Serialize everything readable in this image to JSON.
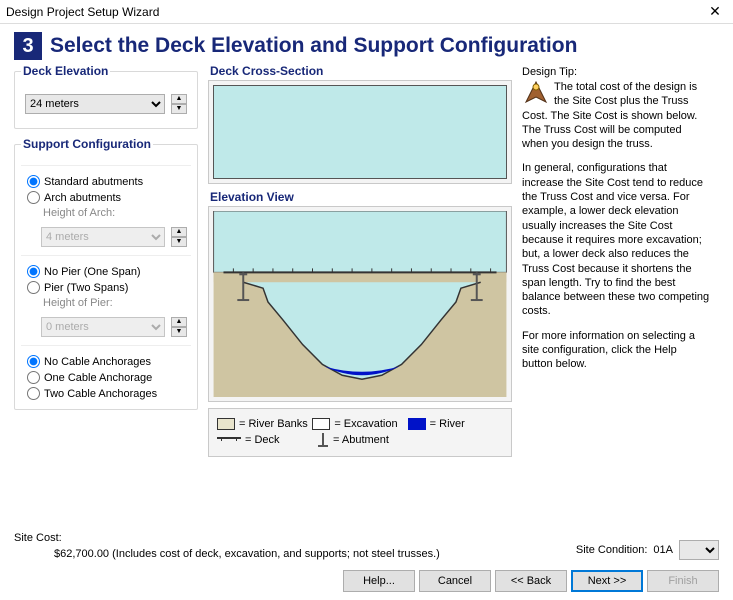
{
  "window": {
    "title": "Design Project Setup Wizard"
  },
  "step": {
    "num": "3",
    "title": "Select the Deck Elevation and Support Configuration"
  },
  "deckElevation": {
    "legend": "Deck Elevation",
    "value": "24 meters"
  },
  "supportConfig": {
    "legend": "Support Configuration",
    "abutments": {
      "standard": "Standard abutments",
      "arch": "Arch abutments",
      "archHeightLabel": "Height of Arch:",
      "archHeightValue": "4 meters"
    },
    "pier": {
      "none": "No Pier (One Span)",
      "one": "Pier (Two Spans)",
      "pierHeightLabel": "Height of Pier:",
      "pierHeightValue": "0 meters"
    },
    "anchor": {
      "none": "No Cable Anchorages",
      "one": "One Cable Anchorage",
      "two": "Two Cable Anchorages"
    }
  },
  "crossSection": {
    "label": "Deck Cross-Section"
  },
  "elevation": {
    "label": "Elevation View"
  },
  "legend": {
    "banks": "= River Banks",
    "exc": "= Excavation",
    "river": "= River",
    "deck": "= Deck",
    "abut": "= Abutment"
  },
  "tip": {
    "header": "Design Tip:",
    "p1": "The total cost of the design is the Site Cost plus the Truss Cost. The Site Cost is shown below. The Truss Cost will be computed when you design the truss.",
    "p2": "In general, configurations that increase the Site Cost tend to reduce the Truss Cost and vice versa. For example, a lower deck elevation usually increases the Site Cost because it requires more excavation; but, a lower deck also reduces the Truss Cost because it shortens the span length. Try to find the best balance between these two competing costs.",
    "p3": "For more information on selecting a site configuration, click the Help button below."
  },
  "siteCost": {
    "label": "Site Cost:",
    "value": "$62,700.00  (Includes cost of deck, excavation, and supports; not steel trusses.)"
  },
  "siteCondition": {
    "label": "Site Condition:",
    "value": "01A"
  },
  "buttons": {
    "help": "Help...",
    "cancel": "Cancel",
    "back": "<< Back",
    "next": "Next >>",
    "finish": "Finish"
  }
}
